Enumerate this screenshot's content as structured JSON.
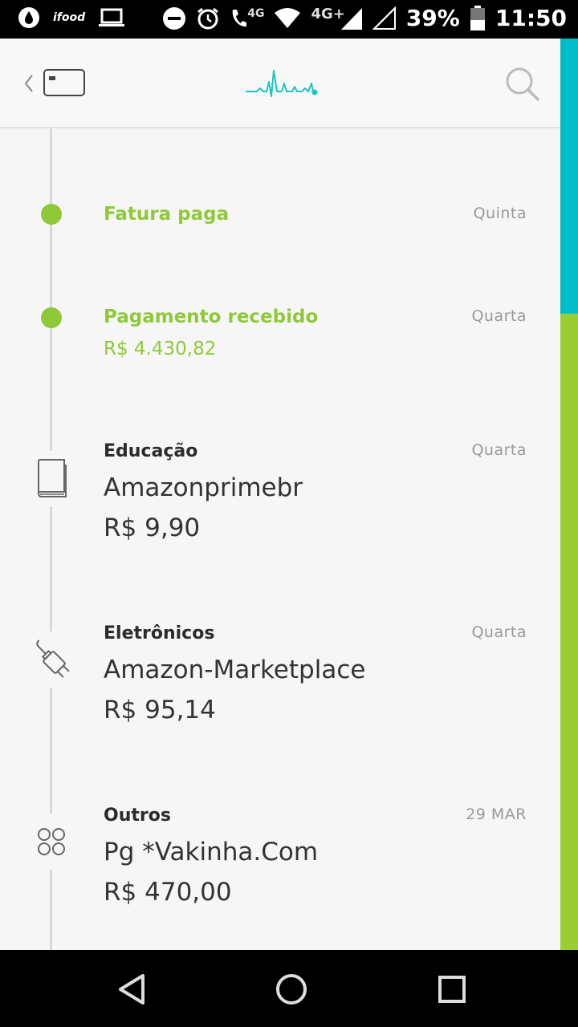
{
  "status_bar": {
    "app_label": "ifood",
    "network_4g": "4G",
    "network_4g_plus": "4G+",
    "battery": "39%",
    "time": "11:50"
  },
  "colors": {
    "accent_green": "#8fc93a",
    "accent_teal": "#00bcc9"
  },
  "header": {
    "back_icon": "chevron-left-icon",
    "card_icon": "credit-card-icon",
    "logo_icon": "pulse-logo-icon",
    "search_icon": "search-icon"
  },
  "feed": {
    "items": [
      {
        "type": "event",
        "title": "Fatura paga",
        "date": "Quinta"
      },
      {
        "type": "event",
        "title": "Pagamento recebido",
        "amount": "R$ 4.430,82",
        "date": "Quarta"
      },
      {
        "type": "purchase",
        "icon": "book-icon",
        "category": "Educação",
        "merchant": "Amazonprimebr",
        "amount": "R$ 9,90",
        "date": "Quarta"
      },
      {
        "type": "purchase",
        "icon": "plug-icon",
        "category": "Eletrônicos",
        "merchant": "Amazon-Marketplace",
        "amount": "R$ 95,14",
        "date": "Quarta"
      },
      {
        "type": "purchase",
        "icon": "grid-circles-icon",
        "category": "Outros",
        "merchant": "Pg *Vakinha.Com",
        "amount": "R$ 470,00",
        "date": "29 MAR"
      }
    ]
  },
  "nav_bar": {
    "back": "triangle-back-icon",
    "home": "circle-home-icon",
    "recents": "square-recents-icon"
  }
}
